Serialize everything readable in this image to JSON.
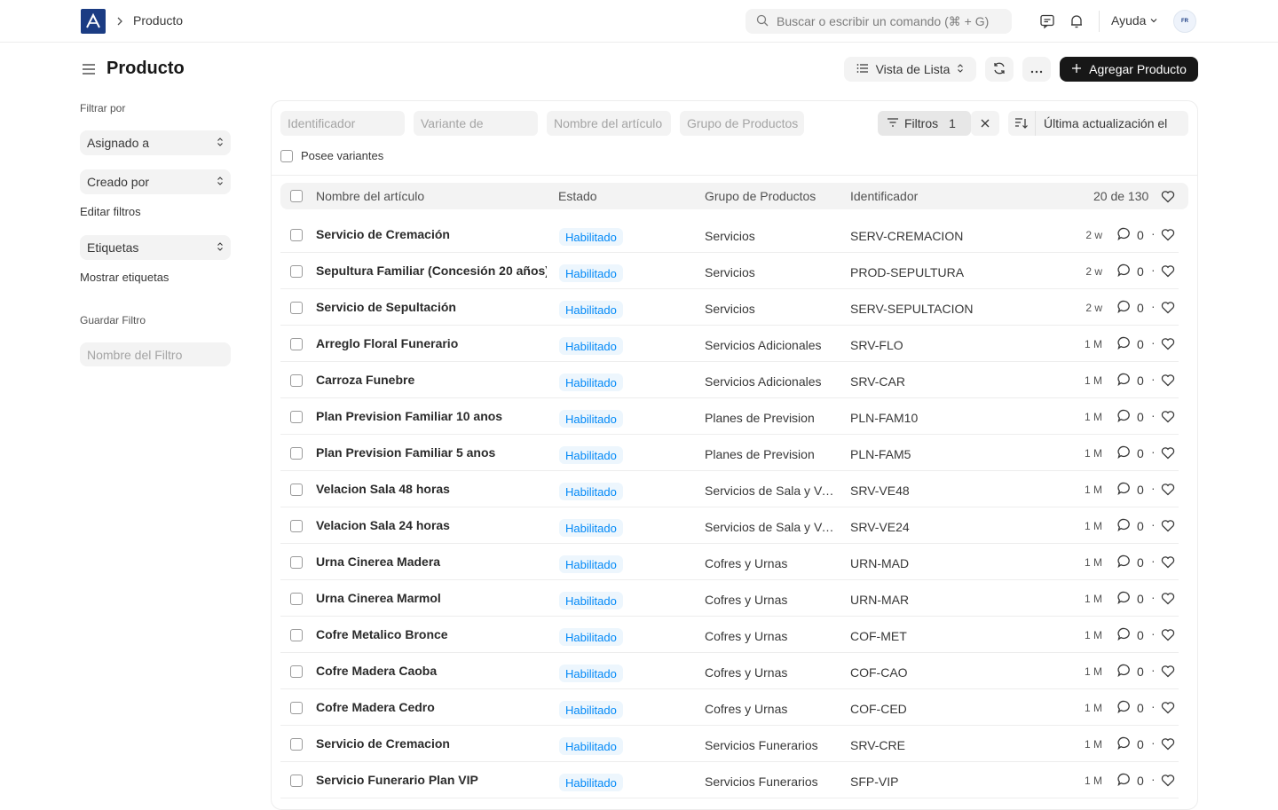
{
  "navbar": {
    "breadcrumb": "Producto",
    "search_placeholder": "Buscar o escribir un comando (⌘ + G)",
    "help_label": "Ayuda",
    "avatar_initials": "FR"
  },
  "header": {
    "title": "Producto",
    "view_label": "Vista de Lista",
    "add_label": "Agregar Producto"
  },
  "sidebar": {
    "filter_by_label": "Filtrar por",
    "assigned_label": "Asignado a",
    "created_by_label": "Creado por",
    "edit_filters_label": "Editar filtros",
    "tags_label": "Etiquetas",
    "show_tags_label": "Mostrar etiquetas",
    "save_filter_label": "Guardar Filtro",
    "filter_name_placeholder": "Nombre del Filtro"
  },
  "filters": {
    "identifier_placeholder": "Identificador",
    "variant_placeholder": "Variante de",
    "item_name_placeholder": "Nombre del artículo",
    "product_group_placeholder": "Grupo de Productos",
    "filters_label": "Filtros",
    "filters_count": "1",
    "sort_label": "Última actualización el",
    "has_variants_label": "Posee variantes"
  },
  "table": {
    "columns": {
      "name": "Nombre del artículo",
      "status": "Estado",
      "group": "Grupo de Productos",
      "identifier": "Identificador"
    },
    "count_label": "20 de 130",
    "rows": [
      {
        "name": "Servicio de Cremación",
        "status": "Habilitado",
        "group": "Servicios",
        "id": "SERV-CREMACION",
        "time": "2 w",
        "comments": "0"
      },
      {
        "name": "Sepultura Familiar (Concesión 20 años)",
        "status": "Habilitado",
        "group": "Servicios",
        "id": "PROD-SEPULTURA",
        "time": "2 w",
        "comments": "0"
      },
      {
        "name": "Servicio de Sepultación",
        "status": "Habilitado",
        "group": "Servicios",
        "id": "SERV-SEPULTACION",
        "time": "2 w",
        "comments": "0"
      },
      {
        "name": "Arreglo Floral Funerario",
        "status": "Habilitado",
        "group": "Servicios Adicionales",
        "id": "SRV-FLO",
        "time": "1 M",
        "comments": "0"
      },
      {
        "name": "Carroza Funebre",
        "status": "Habilitado",
        "group": "Servicios Adicionales",
        "id": "SRV-CAR",
        "time": "1 M",
        "comments": "0"
      },
      {
        "name": "Plan Prevision Familiar 10 anos",
        "status": "Habilitado",
        "group": "Planes de Prevision",
        "id": "PLN-FAM10",
        "time": "1 M",
        "comments": "0"
      },
      {
        "name": "Plan Prevision Familiar 5 anos",
        "status": "Habilitado",
        "group": "Planes de Prevision",
        "id": "PLN-FAM5",
        "time": "1 M",
        "comments": "0"
      },
      {
        "name": "Velacion Sala 48 horas",
        "status": "Habilitado",
        "group": "Servicios de Sala y Velacion",
        "id": "SRV-VE48",
        "time": "1 M",
        "comments": "0"
      },
      {
        "name": "Velacion Sala 24 horas",
        "status": "Habilitado",
        "group": "Servicios de Sala y Velacion",
        "id": "SRV-VE24",
        "time": "1 M",
        "comments": "0"
      },
      {
        "name": "Urna Cinerea Madera",
        "status": "Habilitado",
        "group": "Cofres y Urnas",
        "id": "URN-MAD",
        "time": "1 M",
        "comments": "0"
      },
      {
        "name": "Urna Cinerea Marmol",
        "status": "Habilitado",
        "group": "Cofres y Urnas",
        "id": "URN-MAR",
        "time": "1 M",
        "comments": "0"
      },
      {
        "name": "Cofre Metalico Bronce",
        "status": "Habilitado",
        "group": "Cofres y Urnas",
        "id": "COF-MET",
        "time": "1 M",
        "comments": "0"
      },
      {
        "name": "Cofre Madera Caoba",
        "status": "Habilitado",
        "group": "Cofres y Urnas",
        "id": "COF-CAO",
        "time": "1 M",
        "comments": "0"
      },
      {
        "name": "Cofre Madera Cedro",
        "status": "Habilitado",
        "group": "Cofres y Urnas",
        "id": "COF-CED",
        "time": "1 M",
        "comments": "0"
      },
      {
        "name": "Servicio de Cremacion",
        "status": "Habilitado",
        "group": "Servicios Funerarios",
        "id": "SRV-CRE",
        "time": "1 M",
        "comments": "0"
      },
      {
        "name": "Servicio Funerario Plan VIP",
        "status": "Habilitado",
        "group": "Servicios Funerarios",
        "id": "SFP-VIP",
        "time": "1 M",
        "comments": "0"
      }
    ]
  },
  "icons": {
    "logo": "app-logo-icon",
    "search": "search-icon",
    "chat": "chat-icon",
    "bell": "bell-icon",
    "menu": "hamburger-icon",
    "list": "list-icon",
    "refresh": "refresh-icon",
    "more": "more-icon",
    "plus": "plus-icon",
    "filter": "filter-icon",
    "close": "close-icon",
    "sort": "sort-icon",
    "comment": "comment-icon",
    "heart": "heart-icon"
  },
  "colors": {
    "brand": "#1b3c83",
    "status_text": "#0289f7",
    "status_bg": "#edf6fd",
    "primary_button": "#171717"
  }
}
